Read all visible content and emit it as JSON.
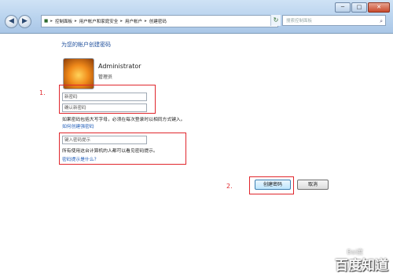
{
  "window": {
    "minimize": "─",
    "maximize": "□",
    "close": "✕"
  },
  "nav": {
    "back": "◀",
    "forward": "▶",
    "crumbs": [
      "控制面板",
      "用户帐户和家庭安全",
      "用户帐户",
      "创建密码"
    ],
    "search_placeholder": "搜索控制面板",
    "search_icon": "search-icon",
    "refresh_icon": "refresh-icon"
  },
  "page": {
    "heading": "为您的帐户创建密码",
    "user": {
      "name": "Administrator",
      "role": "管理员"
    },
    "new_password_placeholder": "新密码",
    "confirm_password_placeholder": "确认新密码",
    "caps_note": "如果密码包括大写字母，必须在每次登录时以相同方式键入。",
    "strong_link": "如何创建强密码",
    "hint_placeholder": "键入密码提示",
    "hint_note": "所有使用这台计算机的人都可以看见密码提示。",
    "hint_link": "密码提示是什么?",
    "create_button": "创建密码",
    "cancel_button": "取消"
  },
  "annotations": {
    "step1": "1.",
    "step2": "2.",
    "accent": "#e0262c"
  },
  "watermark": {
    "main": "百度知道",
    "sub": "Bai度"
  }
}
